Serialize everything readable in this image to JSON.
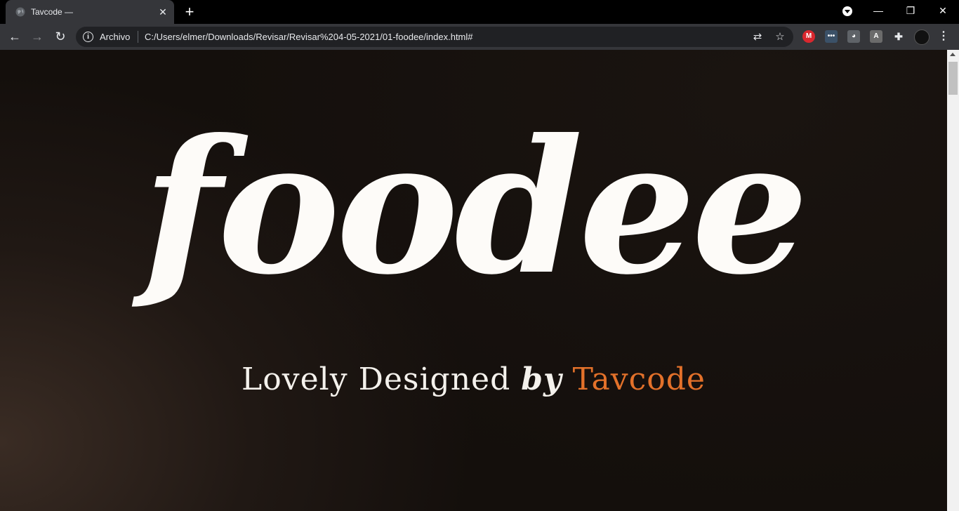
{
  "browser": {
    "tab": {
      "title": "Tavcode —",
      "close_glyph": "✕"
    },
    "new_tab_glyph": "+",
    "window": {
      "minimize": "—",
      "restore": "❐",
      "close": "✕"
    },
    "nav": {
      "back": "←",
      "forward": "→",
      "reload": "↻"
    },
    "address": {
      "info_glyph": "i",
      "scheme_label": "Archivo",
      "url": "C:/Users/elmer/Downloads/Revisar/Revisar%204-05-2021/01-foodee/index.html#"
    },
    "omnibox_icons": {
      "translate": "⇄",
      "bookmark": "☆"
    },
    "extensions": [
      {
        "name": "mega-icon",
        "glyph": "M",
        "color": "#d9272e"
      },
      {
        "name": "dots-extension-icon",
        "glyph": "•••",
        "color": "#3b5168"
      },
      {
        "name": "cat-extension-icon",
        "glyph": "◕",
        "color": "#5f6368"
      },
      {
        "name": "pdf-extension-icon",
        "glyph": "A",
        "color": "#6b6b6b"
      }
    ],
    "puzzle_glyph": "✚",
    "menu_glyph": "⋮"
  },
  "page": {
    "brand": "foodee",
    "tagline": {
      "prefix": "Lovely Designed ",
      "by": "by",
      "author": "Tavcode"
    }
  },
  "colors": {
    "accent": "#e3712a",
    "brand_text": "#fdfbf8",
    "background": "#17110e"
  }
}
